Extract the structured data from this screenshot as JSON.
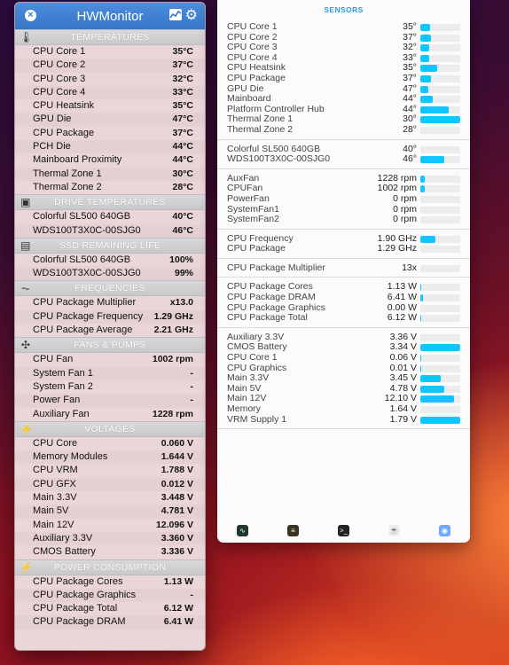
{
  "hwmonitor": {
    "title": "HWMonitor",
    "sections": [
      {
        "id": "temps",
        "label": "TEMPERATURES",
        "icon": "thermometer-icon",
        "rows": [
          {
            "name": "CPU Core 1",
            "value": "35°C"
          },
          {
            "name": "CPU Core 2",
            "value": "37°C"
          },
          {
            "name": "CPU Core 3",
            "value": "32°C"
          },
          {
            "name": "CPU Core 4",
            "value": "33°C"
          },
          {
            "name": "CPU Heatsink",
            "value": "35°C"
          },
          {
            "name": "GPU Die",
            "value": "47°C"
          },
          {
            "name": "CPU Package",
            "value": "37°C"
          },
          {
            "name": "PCH Die",
            "value": "44°C"
          },
          {
            "name": "Mainboard Proximity",
            "value": "44°C"
          },
          {
            "name": "Thermal Zone 1",
            "value": "30°C"
          },
          {
            "name": "Thermal Zone 2",
            "value": "28°C"
          }
        ]
      },
      {
        "id": "drive",
        "label": "DRIVE TEMPERATURES",
        "icon": "drive-icon",
        "rows": [
          {
            "name": "Colorful SL500 640GB",
            "value": "40°C"
          },
          {
            "name": "WDS100T3X0C-00SJG0",
            "value": "46°C"
          }
        ]
      },
      {
        "id": "ssd",
        "label": "SSD REMAINING LIFE",
        "icon": "ssd-icon",
        "rows": [
          {
            "name": "Colorful SL500 640GB",
            "value": "100%"
          },
          {
            "name": "WDS100T3X0C-00SJG0",
            "value": "99%"
          }
        ]
      },
      {
        "id": "freq",
        "label": "FREQUENCIES",
        "icon": "frequency-icon",
        "rows": [
          {
            "name": "CPU Package Multiplier",
            "value": "x13.0"
          },
          {
            "name": "CPU Package Frequency",
            "value": "1.29 GHz"
          },
          {
            "name": "CPU Package Average",
            "value": "2.21 GHz"
          }
        ]
      },
      {
        "id": "fans",
        "label": "FANS & PUMPS",
        "icon": "fan-icon",
        "rows": [
          {
            "name": "CPU Fan",
            "value": "1002 rpm"
          },
          {
            "name": "System Fan 1",
            "value": "-"
          },
          {
            "name": "System Fan 2",
            "value": "-"
          },
          {
            "name": "Power Fan",
            "value": "-"
          },
          {
            "name": "Auxiliary Fan",
            "value": "1228 rpm"
          }
        ]
      },
      {
        "id": "volts",
        "label": "VOLTAGES",
        "icon": "lightning-icon",
        "rows": [
          {
            "name": "CPU Core",
            "value": "0.060 V"
          },
          {
            "name": "Memory Modules",
            "value": "1.644 V"
          },
          {
            "name": "CPU VRM",
            "value": "1.788 V"
          },
          {
            "name": "CPU GFX",
            "value": "0.012 V"
          },
          {
            "name": "Main 3.3V",
            "value": "3.448 V"
          },
          {
            "name": "Main 5V",
            "value": "4.781 V"
          },
          {
            "name": "Main 12V",
            "value": "12.096 V"
          },
          {
            "name": "Auxiliary 3.3V",
            "value": "3.360 V"
          },
          {
            "name": "CMOS Battery",
            "value": "3.336 V"
          }
        ]
      },
      {
        "id": "power",
        "label": "POWER CONSUMPTION",
        "icon": "lightning-icon",
        "rows": [
          {
            "name": "CPU Package Cores",
            "value": "1.13 W"
          },
          {
            "name": "CPU Package Graphics",
            "value": "-"
          },
          {
            "name": "CPU Package Total",
            "value": "6.12 W"
          },
          {
            "name": "CPU Package DRAM",
            "value": "6.41 W"
          }
        ]
      }
    ]
  },
  "sensors": {
    "title": "SENSORS",
    "groups": [
      {
        "id": "temps",
        "rows": [
          {
            "name": "CPU Core 1",
            "value": "35°",
            "level": 0.25
          },
          {
            "name": "CPU Core 2",
            "value": "37°",
            "level": 0.27
          },
          {
            "name": "CPU Core 3",
            "value": "32°",
            "level": 0.22
          },
          {
            "name": "CPU Core 4",
            "value": "33°",
            "level": 0.23
          },
          {
            "name": "CPU Heatsink",
            "value": "35°",
            "level": 0.42
          },
          {
            "name": "CPU Package",
            "value": "37°",
            "level": 0.27
          },
          {
            "name": "GPU Die",
            "value": "47°",
            "level": 0.2
          },
          {
            "name": "Mainboard",
            "value": "44°",
            "level": 0.3
          },
          {
            "name": "Platform Controller Hub",
            "value": "44°",
            "level": 0.7
          },
          {
            "name": "Thermal Zone 1",
            "value": "30°",
            "level": 1.0
          },
          {
            "name": "Thermal Zone 2",
            "value": "28°",
            "level": 0
          }
        ]
      },
      {
        "id": "drives",
        "rows": [
          {
            "name": "Colorful SL500 640GB",
            "value": "40°",
            "level": 0
          },
          {
            "name": "WDS100T3X0C-00SJG0",
            "value": "46°",
            "level": 0.6
          }
        ]
      },
      {
        "id": "fans",
        "rows": [
          {
            "name": "AuxFan",
            "value": "1228 rpm",
            "level": 0.12
          },
          {
            "name": "CPUFan",
            "value": "1002 rpm",
            "level": 0.1
          },
          {
            "name": "PowerFan",
            "value": "0 rpm",
            "level": 0
          },
          {
            "name": "SystemFan1",
            "value": "0 rpm",
            "level": 0
          },
          {
            "name": "SystemFan2",
            "value": "0 rpm",
            "level": 0
          }
        ]
      },
      {
        "id": "freq",
        "rows": [
          {
            "name": "CPU Frequency",
            "value": "1.90 GHz",
            "level": 0.37
          },
          {
            "name": "CPU Package",
            "value": "1.29 GHz",
            "level": 0
          }
        ]
      },
      {
        "id": "mult",
        "rows": [
          {
            "name": "CPU Package Multiplier",
            "value": "13x",
            "level": 0
          }
        ]
      },
      {
        "id": "power",
        "rows": [
          {
            "name": "CPU Package Cores",
            "value": "1.13 W",
            "level": 0.03
          },
          {
            "name": "CPU Package DRAM",
            "value": "6.41 W",
            "level": 0.06
          },
          {
            "name": "CPU Package Graphics",
            "value": "0.00 W",
            "level": 0
          },
          {
            "name": "CPU Package Total",
            "value": "6.12 W",
            "level": 0.03
          }
        ]
      },
      {
        "id": "volts",
        "rows": [
          {
            "name": "Auxiliary 3.3V",
            "value": "3.36 V",
            "level": 0
          },
          {
            "name": "CMOS Battery",
            "value": "3.34 V",
            "level": 1.0
          },
          {
            "name": "CPU Core 1",
            "value": "0.06 V",
            "level": 0.02
          },
          {
            "name": "CPU Graphics",
            "value": "0.01 V",
            "level": 0.01
          },
          {
            "name": "Main 3.3V",
            "value": "3.45 V",
            "level": 0.5
          },
          {
            "name": "Main 5V",
            "value": "4.78 V",
            "level": 0.6
          },
          {
            "name": "Main 12V",
            "value": "12.10 V",
            "level": 0.85
          },
          {
            "name": "Memory",
            "value": "1.64 V",
            "level": 0
          },
          {
            "name": "VRM Supply 1",
            "value": "1.79 V",
            "level": 1.0
          }
        ]
      }
    ],
    "dock": [
      {
        "name": "activity-monitor-icon",
        "label": ""
      },
      {
        "name": "console-icon",
        "label": ""
      },
      {
        "name": "terminal-icon",
        "label": ""
      },
      {
        "name": "coffee-icon",
        "label": ""
      },
      {
        "name": "browser-icon",
        "label": ""
      }
    ]
  },
  "colors": {
    "accent": "#3576c9",
    "bar": "#11c5ff",
    "sensorsTitle": "#2e9ae6"
  }
}
